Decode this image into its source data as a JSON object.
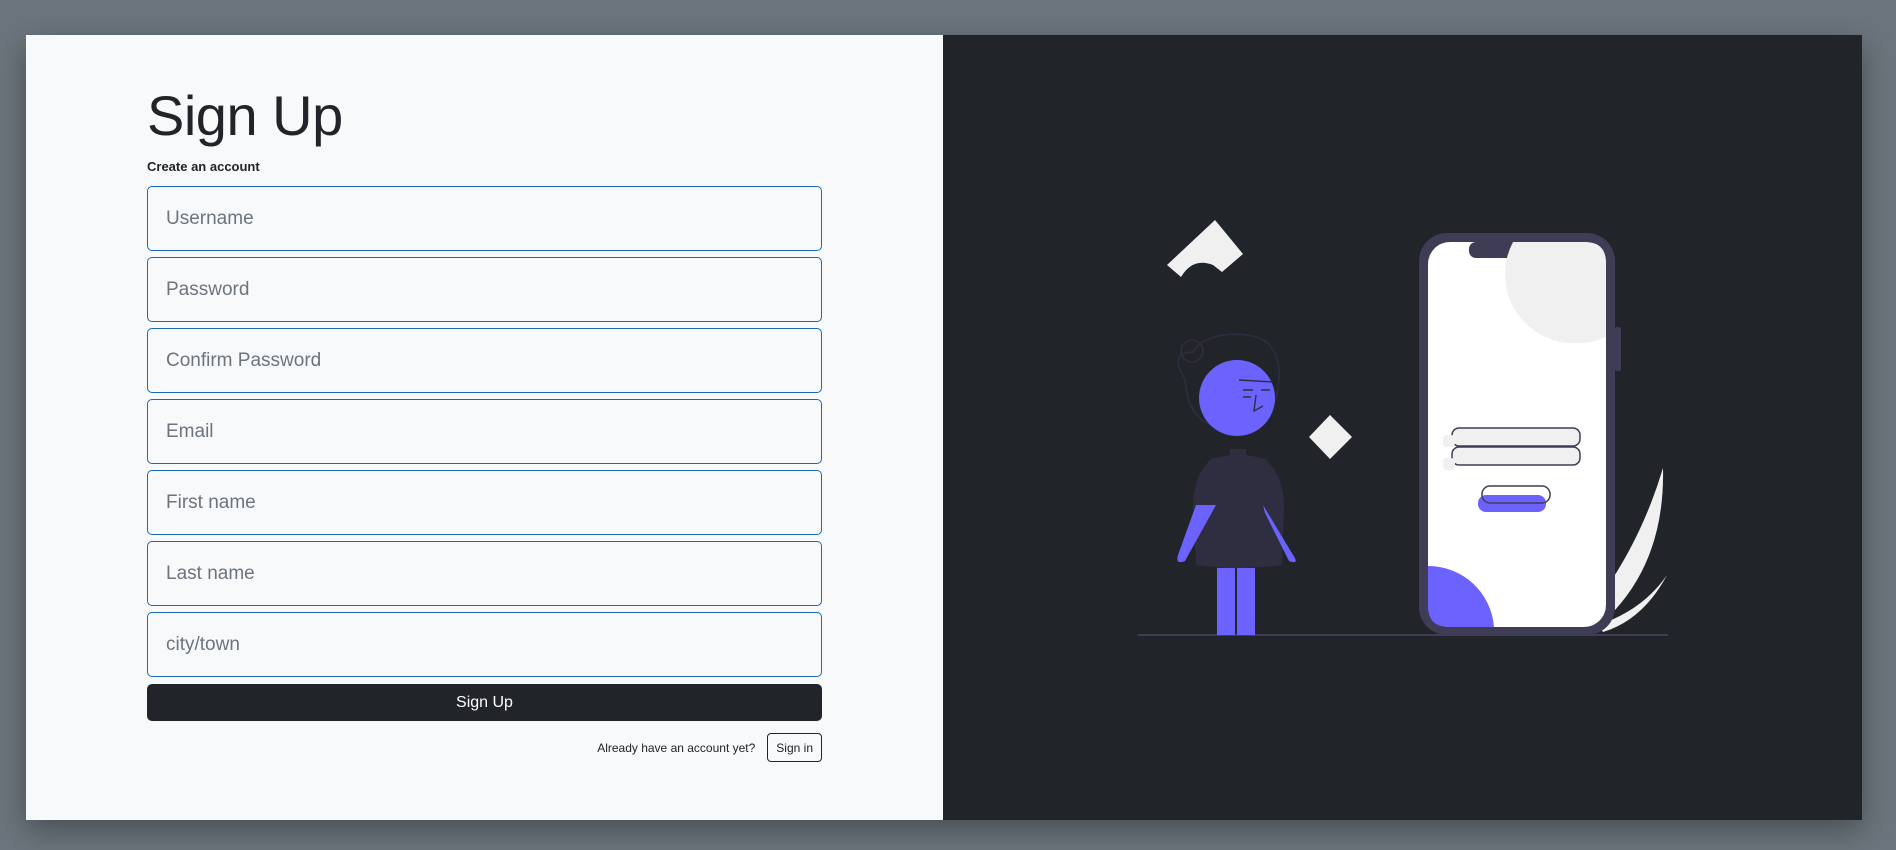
{
  "form": {
    "title": "Sign Up",
    "subtitle": "Create an account",
    "fields": [
      {
        "placeholder": "Username",
        "value": ""
      },
      {
        "placeholder": "Password",
        "value": ""
      },
      {
        "placeholder": "Confirm Password",
        "value": ""
      },
      {
        "placeholder": "Email",
        "value": ""
      },
      {
        "placeholder": "First name",
        "value": ""
      },
      {
        "placeholder": "Last name",
        "value": ""
      },
      {
        "placeholder": "city/town",
        "value": ""
      }
    ],
    "submit_label": "Sign Up",
    "signin_prompt": "Already have an account yet?",
    "signin_label": "Sign in"
  },
  "colors": {
    "page_bg": "#6c757d",
    "form_bg": "#f8f9fa",
    "dark_panel": "#212529",
    "accent_purple": "#6c63ff",
    "input_border": "#1c6bb0"
  },
  "illustration": {
    "name": "person-with-phone-signup-illustration"
  }
}
